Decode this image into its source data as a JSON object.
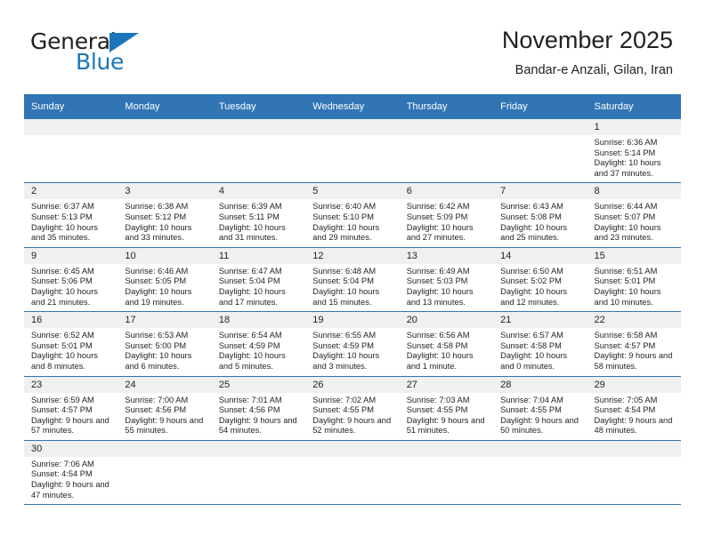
{
  "brand": {
    "name_part1": "General",
    "name_part2": "Blue"
  },
  "header": {
    "title": "November 2025",
    "subtitle": "Bandar-e Anzali, Gilan, Iran"
  },
  "colors": {
    "header_blue": "#3175b5",
    "brand_blue": "#1b75bb",
    "daynum_bg": "#f0f0f0",
    "text": "#231f20"
  },
  "weekdays": [
    "Sunday",
    "Monday",
    "Tuesday",
    "Wednesday",
    "Thursday",
    "Friday",
    "Saturday"
  ],
  "labels": {
    "sunrise": "Sunrise:",
    "sunset": "Sunset:",
    "daylight": "Daylight:"
  },
  "weeks": [
    [
      {
        "empty": true
      },
      {
        "empty": true
      },
      {
        "empty": true
      },
      {
        "empty": true
      },
      {
        "empty": true
      },
      {
        "empty": true
      },
      {
        "day": "1",
        "sunrise": "Sunrise: 6:36 AM",
        "sunset": "Sunset: 5:14 PM",
        "daylight": "Daylight: 10 hours and 37 minutes."
      }
    ],
    [
      {
        "day": "2",
        "sunrise": "Sunrise: 6:37 AM",
        "sunset": "Sunset: 5:13 PM",
        "daylight": "Daylight: 10 hours and 35 minutes."
      },
      {
        "day": "3",
        "sunrise": "Sunrise: 6:38 AM",
        "sunset": "Sunset: 5:12 PM",
        "daylight": "Daylight: 10 hours and 33 minutes."
      },
      {
        "day": "4",
        "sunrise": "Sunrise: 6:39 AM",
        "sunset": "Sunset: 5:11 PM",
        "daylight": "Daylight: 10 hours and 31 minutes."
      },
      {
        "day": "5",
        "sunrise": "Sunrise: 6:40 AM",
        "sunset": "Sunset: 5:10 PM",
        "daylight": "Daylight: 10 hours and 29 minutes."
      },
      {
        "day": "6",
        "sunrise": "Sunrise: 6:42 AM",
        "sunset": "Sunset: 5:09 PM",
        "daylight": "Daylight: 10 hours and 27 minutes."
      },
      {
        "day": "7",
        "sunrise": "Sunrise: 6:43 AM",
        "sunset": "Sunset: 5:08 PM",
        "daylight": "Daylight: 10 hours and 25 minutes."
      },
      {
        "day": "8",
        "sunrise": "Sunrise: 6:44 AM",
        "sunset": "Sunset: 5:07 PM",
        "daylight": "Daylight: 10 hours and 23 minutes."
      }
    ],
    [
      {
        "day": "9",
        "sunrise": "Sunrise: 6:45 AM",
        "sunset": "Sunset: 5:06 PM",
        "daylight": "Daylight: 10 hours and 21 minutes."
      },
      {
        "day": "10",
        "sunrise": "Sunrise: 6:46 AM",
        "sunset": "Sunset: 5:05 PM",
        "daylight": "Daylight: 10 hours and 19 minutes."
      },
      {
        "day": "11",
        "sunrise": "Sunrise: 6:47 AM",
        "sunset": "Sunset: 5:04 PM",
        "daylight": "Daylight: 10 hours and 17 minutes."
      },
      {
        "day": "12",
        "sunrise": "Sunrise: 6:48 AM",
        "sunset": "Sunset: 5:04 PM",
        "daylight": "Daylight: 10 hours and 15 minutes."
      },
      {
        "day": "13",
        "sunrise": "Sunrise: 6:49 AM",
        "sunset": "Sunset: 5:03 PM",
        "daylight": "Daylight: 10 hours and 13 minutes."
      },
      {
        "day": "14",
        "sunrise": "Sunrise: 6:50 AM",
        "sunset": "Sunset: 5:02 PM",
        "daylight": "Daylight: 10 hours and 12 minutes."
      },
      {
        "day": "15",
        "sunrise": "Sunrise: 6:51 AM",
        "sunset": "Sunset: 5:01 PM",
        "daylight": "Daylight: 10 hours and 10 minutes."
      }
    ],
    [
      {
        "day": "16",
        "sunrise": "Sunrise: 6:52 AM",
        "sunset": "Sunset: 5:01 PM",
        "daylight": "Daylight: 10 hours and 8 minutes."
      },
      {
        "day": "17",
        "sunrise": "Sunrise: 6:53 AM",
        "sunset": "Sunset: 5:00 PM",
        "daylight": "Daylight: 10 hours and 6 minutes."
      },
      {
        "day": "18",
        "sunrise": "Sunrise: 6:54 AM",
        "sunset": "Sunset: 4:59 PM",
        "daylight": "Daylight: 10 hours and 5 minutes."
      },
      {
        "day": "19",
        "sunrise": "Sunrise: 6:55 AM",
        "sunset": "Sunset: 4:59 PM",
        "daylight": "Daylight: 10 hours and 3 minutes."
      },
      {
        "day": "20",
        "sunrise": "Sunrise: 6:56 AM",
        "sunset": "Sunset: 4:58 PM",
        "daylight": "Daylight: 10 hours and 1 minute."
      },
      {
        "day": "21",
        "sunrise": "Sunrise: 6:57 AM",
        "sunset": "Sunset: 4:58 PM",
        "daylight": "Daylight: 10 hours and 0 minutes."
      },
      {
        "day": "22",
        "sunrise": "Sunrise: 6:58 AM",
        "sunset": "Sunset: 4:57 PM",
        "daylight": "Daylight: 9 hours and 58 minutes."
      }
    ],
    [
      {
        "day": "23",
        "sunrise": "Sunrise: 6:59 AM",
        "sunset": "Sunset: 4:57 PM",
        "daylight": "Daylight: 9 hours and 57 minutes."
      },
      {
        "day": "24",
        "sunrise": "Sunrise: 7:00 AM",
        "sunset": "Sunset: 4:56 PM",
        "daylight": "Daylight: 9 hours and 55 minutes."
      },
      {
        "day": "25",
        "sunrise": "Sunrise: 7:01 AM",
        "sunset": "Sunset: 4:56 PM",
        "daylight": "Daylight: 9 hours and 54 minutes."
      },
      {
        "day": "26",
        "sunrise": "Sunrise: 7:02 AM",
        "sunset": "Sunset: 4:55 PM",
        "daylight": "Daylight: 9 hours and 52 minutes."
      },
      {
        "day": "27",
        "sunrise": "Sunrise: 7:03 AM",
        "sunset": "Sunset: 4:55 PM",
        "daylight": "Daylight: 9 hours and 51 minutes."
      },
      {
        "day": "28",
        "sunrise": "Sunrise: 7:04 AM",
        "sunset": "Sunset: 4:55 PM",
        "daylight": "Daylight: 9 hours and 50 minutes."
      },
      {
        "day": "29",
        "sunrise": "Sunrise: 7:05 AM",
        "sunset": "Sunset: 4:54 PM",
        "daylight": "Daylight: 9 hours and 48 minutes."
      }
    ],
    [
      {
        "day": "30",
        "sunrise": "Sunrise: 7:06 AM",
        "sunset": "Sunset: 4:54 PM",
        "daylight": "Daylight: 9 hours and 47 minutes."
      },
      {
        "empty": true
      },
      {
        "empty": true
      },
      {
        "empty": true
      },
      {
        "empty": true
      },
      {
        "empty": true
      },
      {
        "empty": true
      }
    ]
  ]
}
